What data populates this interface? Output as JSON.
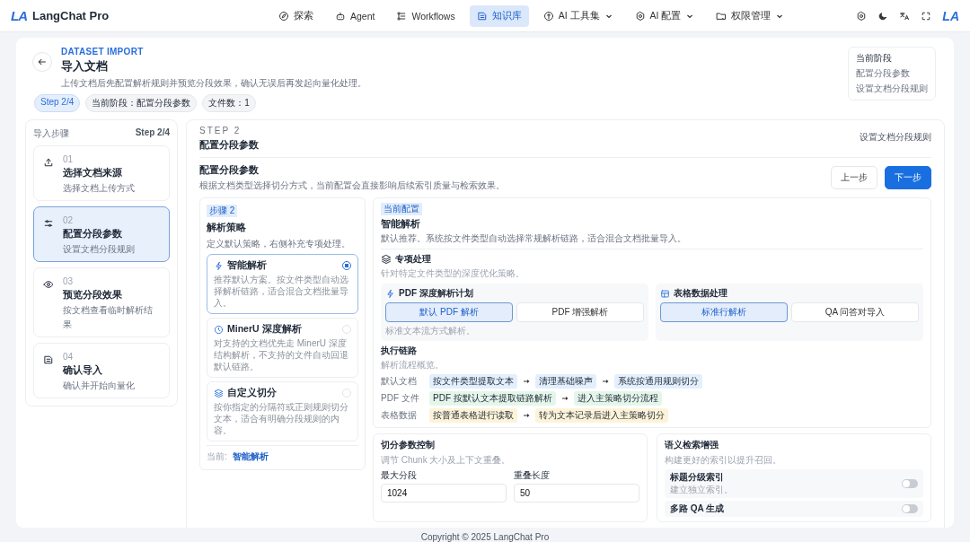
{
  "brand": {
    "mark": "LA",
    "name": "LangChat Pro"
  },
  "nav": [
    {
      "label": "探索",
      "dropdown": false,
      "selected": false
    },
    {
      "label": "Agent",
      "dropdown": false,
      "selected": false
    },
    {
      "label": "Workflows",
      "dropdown": false,
      "selected": false
    },
    {
      "label": "知识库",
      "dropdown": false,
      "selected": true
    },
    {
      "label": "AI 工具集",
      "dropdown": true,
      "selected": false
    },
    {
      "label": "AI 配置",
      "dropdown": true,
      "selected": false
    },
    {
      "label": "权限管理",
      "dropdown": true,
      "selected": false
    }
  ],
  "avatar": "LA",
  "page": {
    "eyebrow": "DATASET IMPORT",
    "title": "导入文档",
    "description": "上传文档后先配置解析规则并预览分段效果，确认无误后再发起向量化处理。",
    "chips": [
      {
        "label": "Step 2/4",
        "kind": "accent"
      },
      {
        "label": "当前阶段：配置分段参数",
        "kind": "plain"
      },
      {
        "label": "文件数：1",
        "kind": "plain"
      }
    ],
    "stage_card": [
      "当前阶段",
      "配置分段参数",
      "设置文档分段规则"
    ]
  },
  "steps": {
    "title": "导入步骤",
    "counter": "Step 2/4",
    "items": [
      {
        "number": "01",
        "title": "选择文档来源",
        "description": "选择文档上传方式",
        "selected": false
      },
      {
        "number": "02",
        "title": "配置分段参数",
        "description": "设置文档分段规则",
        "selected": true
      },
      {
        "number": "03",
        "title": "预览分段效果",
        "description": "按文档查看临时解析结果",
        "selected": false
      },
      {
        "number": "04",
        "title": "确认导入",
        "description": "确认并开始向量化",
        "selected": false
      }
    ]
  },
  "content": {
    "eyebrow": "STEP 2",
    "title": "配置分段参数",
    "aside": "设置文档分段规则",
    "section_title": "配置分段参数",
    "section_description": "根据文档类型选择切分方式，当前配置会直接影响后续索引质量与检索效果。",
    "buttons": [
      {
        "label": "上一步",
        "kind": "secondary"
      },
      {
        "label": "下一步",
        "kind": "primary"
      }
    ],
    "strategy": {
      "badge": "步骤 2",
      "title": "解析策略",
      "description": "定义默认策略，右侧补充专项处理。",
      "options": [
        {
          "title": "智能解析",
          "description": "推荐默认方案。按文件类型自动选择解析链路，适合混合文档批量导入。",
          "selected": true
        },
        {
          "title": "MinerU 深度解析",
          "description": "对支持的文档优先走 MinerU 深度结构解析，不支持的文件自动回退默认链路。",
          "selected": false
        },
        {
          "title": "自定义切分",
          "description": "按你指定的分隔符或正则规则切分文本，适合有明确分段规则的内容。",
          "selected": false
        }
      ],
      "current_label": "当前:",
      "current_value": "智能解析"
    },
    "config": {
      "badge": "当前配置",
      "title": "智能解析",
      "description": "默认推荐。系统按文件类型自动选择常规解析链路，适合混合文档批量导入。",
      "special_title": "专项处理",
      "special_description": "针对特定文件类型的深度优化策略。",
      "panels": [
        {
          "title": "PDF 深度解析计划",
          "options": [
            {
              "label": "默认 PDF 解析",
              "selected": true
            },
            {
              "label": "PDF 增强解析",
              "selected": false
            }
          ],
          "hint": "标准文本流方式解析。"
        },
        {
          "title": "表格数据处理",
          "options": [
            {
              "label": "标准行解析",
              "selected": true
            },
            {
              "label": "QA 问答对导入",
              "selected": false
            }
          ]
        }
      ],
      "chain_title": "执行链路",
      "chain_description": "解析流程概览。",
      "chains": [
        {
          "label": "默认文档",
          "color": "#e3effd",
          "steps": [
            "按文件类型提取文本",
            "清理基础噪声",
            "系统按通用规则切分"
          ]
        },
        {
          "label": "PDF 文件",
          "color": "#e4f6ea",
          "steps": [
            "PDF 按默认文本提取链路解析",
            "进入主策略切分流程"
          ]
        },
        {
          "label": "表格数据",
          "color": "#fdf3d8",
          "steps": [
            "按普通表格进行读取",
            "转为文本记录后进入主策略切分"
          ]
        }
      ]
    },
    "chunk": {
      "title": "切分参数控制",
      "description": "调节 Chunk 大小及上下文重叠。",
      "fields": [
        {
          "label": "最大分段",
          "value": "1024"
        },
        {
          "label": "重叠长度",
          "value": "50"
        }
      ]
    },
    "semantic": {
      "title": "语义检索增强",
      "description": "构建更好的索引以提升召回。",
      "toggles": [
        {
          "title": "标题分级索引",
          "description": "建立独立索引。",
          "on": false
        },
        {
          "title": "多路 QA 生成",
          "on": false
        }
      ]
    }
  },
  "footer": "Copyright © 2025 LangChat Pro"
}
